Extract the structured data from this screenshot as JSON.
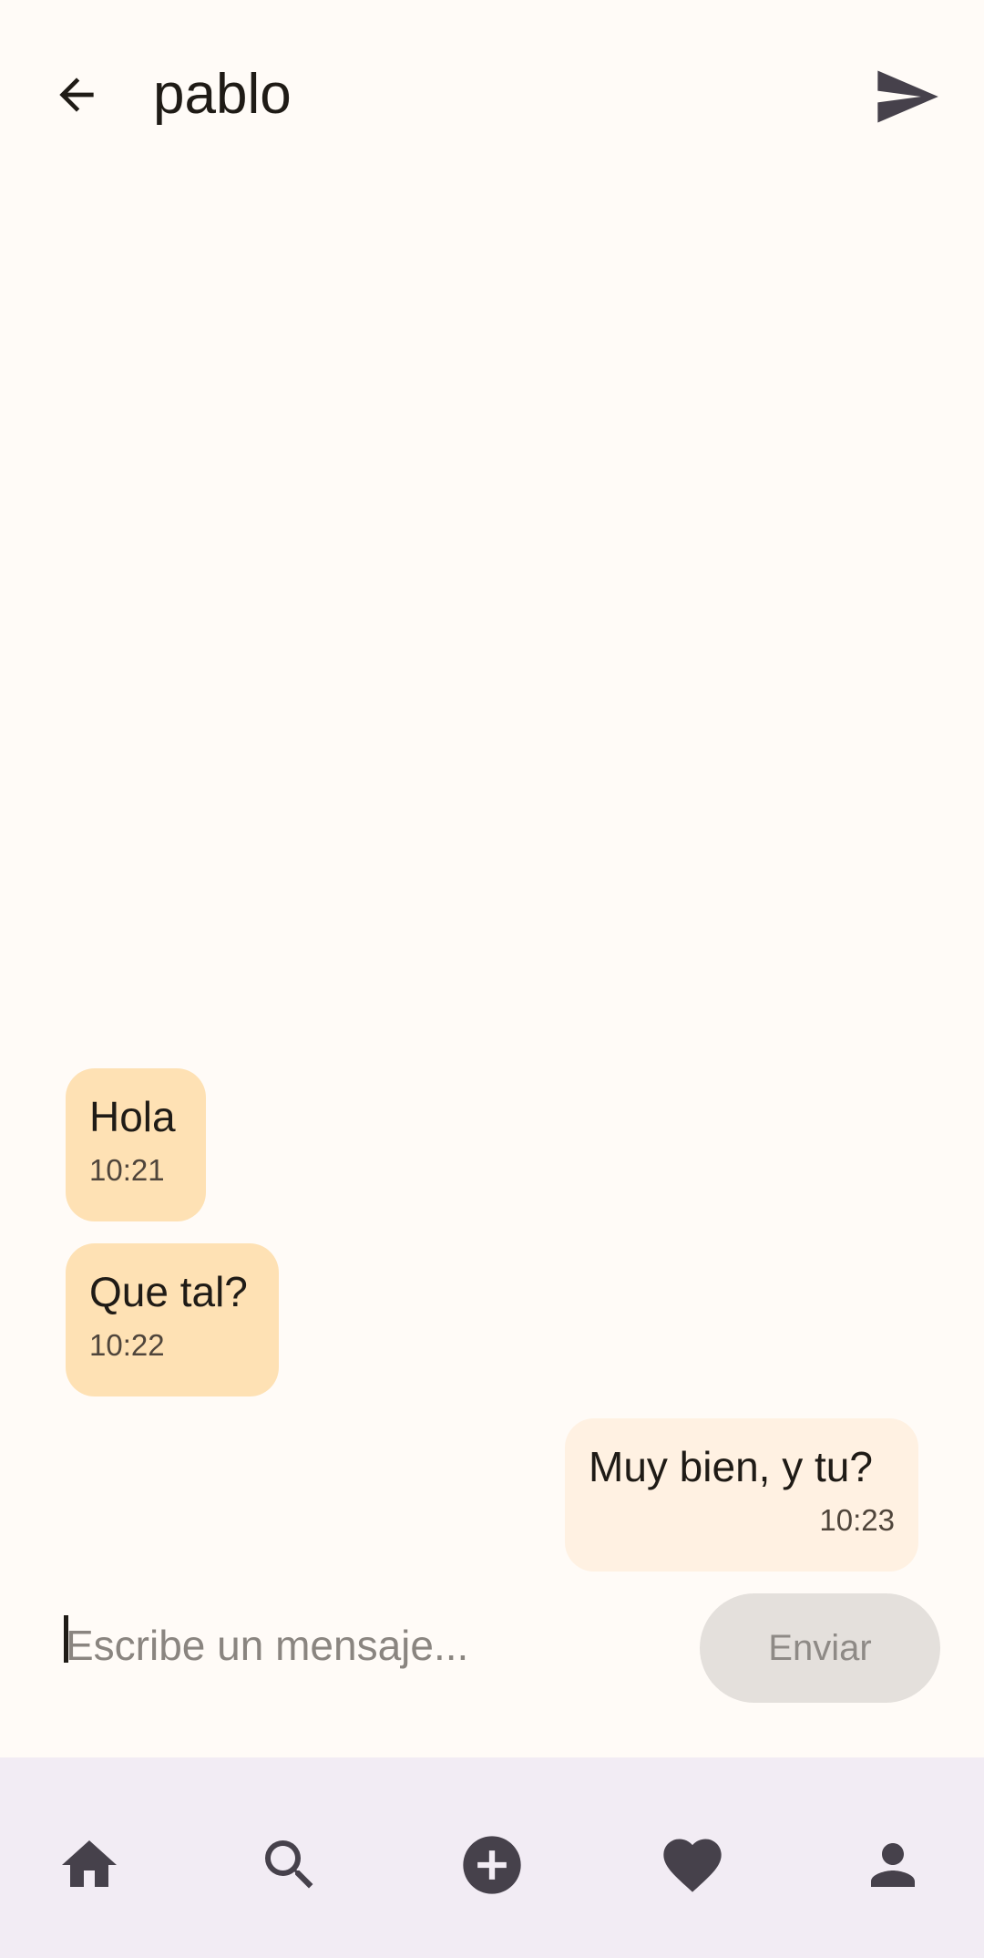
{
  "header": {
    "title": "pablo",
    "back_icon": "arrow-back-icon",
    "send_icon": "send-icon"
  },
  "messages": [
    {
      "direction": "incoming",
      "text": "Hola",
      "time": "10:21"
    },
    {
      "direction": "incoming",
      "text": "Que tal?",
      "time": "10:22"
    },
    {
      "direction": "outgoing",
      "text": "Muy bien, y tu?",
      "time": "10:23"
    }
  ],
  "composer": {
    "value": "",
    "placeholder": "Escribe un mensaje...",
    "send_label": "Enviar"
  },
  "bottom_nav": [
    {
      "icon": "home-icon"
    },
    {
      "icon": "search-icon"
    },
    {
      "icon": "add-circle-icon"
    },
    {
      "icon": "favorite-icon"
    },
    {
      "icon": "person-icon"
    }
  ],
  "colors": {
    "background": "#FFFBF7",
    "incoming_bubble": "#FEE1B4",
    "outgoing_bubble": "#FFF1E2",
    "nav_background": "#F2ECF4",
    "icon": "#46414B",
    "send_button": "#E4E0DC"
  }
}
